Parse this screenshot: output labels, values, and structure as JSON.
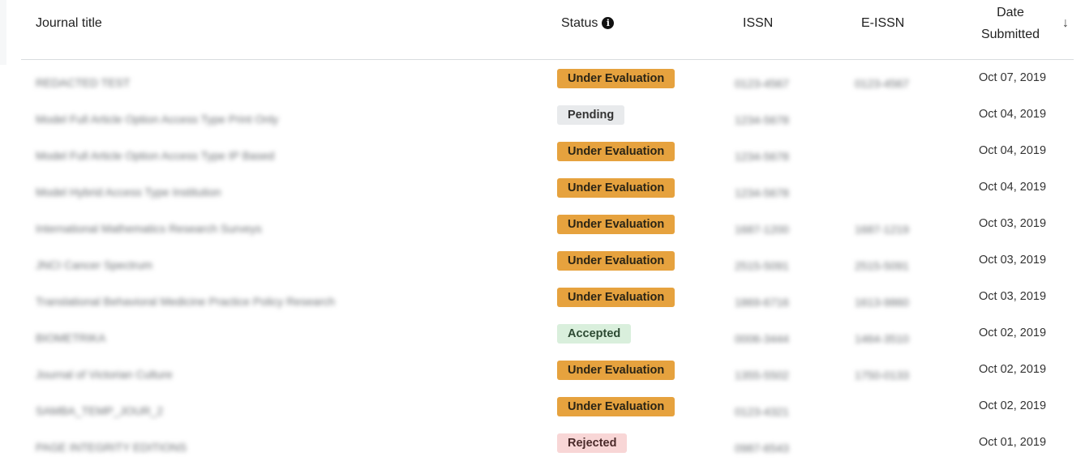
{
  "header": {
    "journal_title": "Journal title",
    "status": "Status",
    "issn": "ISSN",
    "eissn": "E-ISSN",
    "date_line1": "Date",
    "date_line2": "Submitted",
    "info_icon": "i",
    "sort_icon": "↓"
  },
  "rows": [
    {
      "title": "REDACTED TEST",
      "status": "Under Evaluation",
      "status_kind": "eval",
      "issn": "0123-4567",
      "eissn": "0123-4567",
      "date": "Oct 07, 2019"
    },
    {
      "title": "Model Full Article Option Access Type Print Only",
      "status": "Pending",
      "status_kind": "pending",
      "issn": "1234-5678",
      "eissn": "",
      "date": "Oct 04, 2019"
    },
    {
      "title": "Model Full Article Option Access Type IP Based",
      "status": "Under Evaluation",
      "status_kind": "eval",
      "issn": "1234-5678",
      "eissn": "",
      "date": "Oct 04, 2019"
    },
    {
      "title": "Model Hybrid Access Type Institution",
      "status": "Under Evaluation",
      "status_kind": "eval",
      "issn": "1234-5678",
      "eissn": "",
      "date": "Oct 04, 2019"
    },
    {
      "title": "International Mathematics Research Surveys",
      "status": "Under Evaluation",
      "status_kind": "eval",
      "issn": "1687-1200",
      "eissn": "1687-1219",
      "date": "Oct 03, 2019"
    },
    {
      "title": "JNCI Cancer Spectrum",
      "status": "Under Evaluation",
      "status_kind": "eval",
      "issn": "2515-5091",
      "eissn": "2515-5091",
      "date": "Oct 03, 2019"
    },
    {
      "title": "Translational Behavioral Medicine Practice Policy Research",
      "status": "Under Evaluation",
      "status_kind": "eval",
      "issn": "1869-6716",
      "eissn": "1613-9860",
      "date": "Oct 03, 2019"
    },
    {
      "title": "BIOMETRIKA",
      "status": "Accepted",
      "status_kind": "accepted",
      "issn": "0006-3444",
      "eissn": "1464-3510",
      "date": "Oct 02, 2019"
    },
    {
      "title": "Journal of Victorian Culture",
      "status": "Under Evaluation",
      "status_kind": "eval",
      "issn": "1355-5502",
      "eissn": "1750-0133",
      "date": "Oct 02, 2019"
    },
    {
      "title": "SAMBA_TEMP_JOUR_2",
      "status": "Under Evaluation",
      "status_kind": "eval",
      "issn": "0123-4321",
      "eissn": "",
      "date": "Oct 02, 2019"
    },
    {
      "title": "PAGE INTEGRITY EDITIONS",
      "status": "Rejected",
      "status_kind": "rejected",
      "issn": "0987-6543",
      "eissn": "",
      "date": "Oct 01, 2019"
    }
  ]
}
